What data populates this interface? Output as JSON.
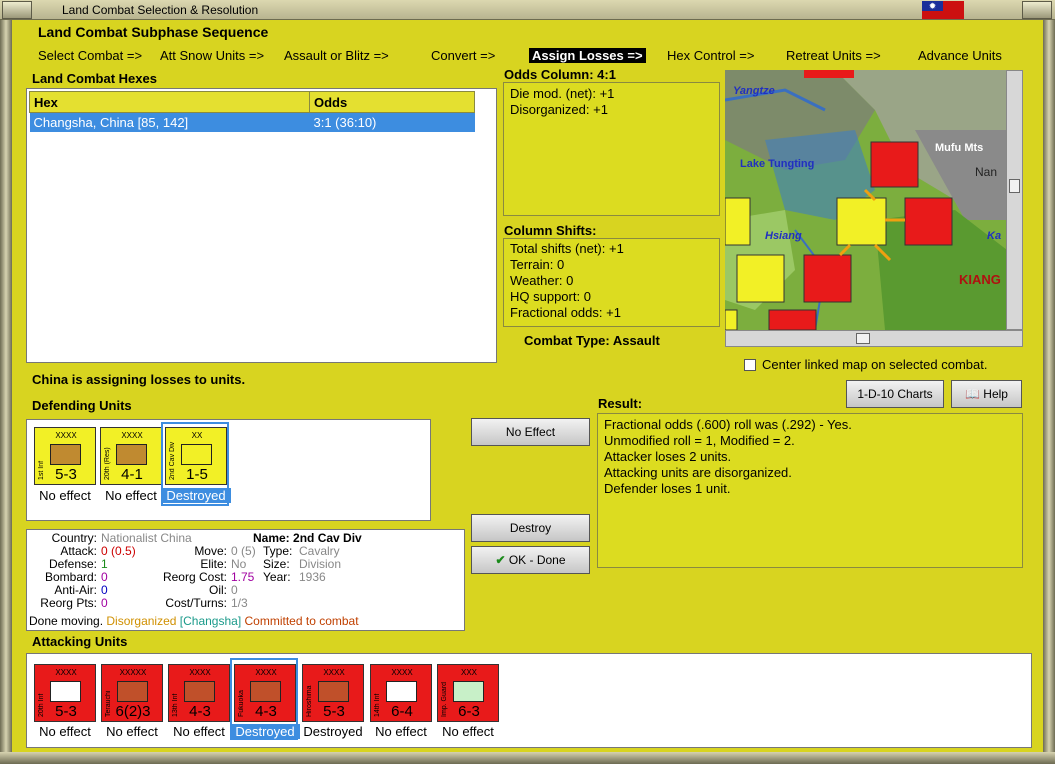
{
  "window": {
    "title": "Land Combat Selection & Resolution"
  },
  "subphase": {
    "header": "Land Combat Subphase Sequence",
    "steps": [
      "Select Combat =>",
      "Att Snow Units =>",
      "Assault or Blitz =>",
      "Convert =>",
      "Assign Losses =>",
      "Hex Control =>",
      "Retreat Units =>",
      "Advance Units"
    ],
    "active_index": 4
  },
  "hexes": {
    "header": "Land Combat Hexes",
    "col_hex": "Hex",
    "col_odds": "Odds",
    "rows": [
      {
        "hex": "Changsha, China [85, 142]",
        "odds": "3:1 (36:10)"
      }
    ]
  },
  "odds": {
    "header": "Odds Column: 4:1",
    "lines": [
      "Die mod. (net): +1",
      "Disorganized: +1"
    ]
  },
  "shifts": {
    "header": "Column Shifts:",
    "lines": [
      "Total shifts (net): +1",
      "Terrain: 0",
      "Weather: 0",
      "HQ support: 0",
      "Fractional odds: +1"
    ]
  },
  "combat_type": "Combat Type:  Assault",
  "map": {
    "labels": [
      "Yangtze",
      "Lake Tungting",
      "Mufu Mts",
      "Hsiang",
      "Nan",
      "KIANG",
      "Ka"
    ],
    "center_checkbox": "Center linked map on selected combat."
  },
  "status_message": "China is assigning losses to units.",
  "defending": {
    "header": "Defending Units",
    "units": [
      {
        "size": "XXXX",
        "name": "1st Inf",
        "value": "5-3",
        "status": "No effect",
        "color": "yel"
      },
      {
        "size": "XXXX",
        "name": "20th (Res)",
        "value": "4-1",
        "status": "No effect",
        "color": "yel"
      },
      {
        "size": "XX",
        "name": "2nd Cav Div",
        "value": "1-5",
        "status": "Destroyed",
        "color": "yel"
      }
    ]
  },
  "buttons": {
    "no_effect": "No Effect",
    "destroy": "Destroy",
    "ok_done": "OK - Done",
    "charts": "1-D-10 Charts",
    "help": "Help"
  },
  "result": {
    "header": "Result:",
    "lines": [
      "Fractional odds (.600) roll was (.292)  - Yes.",
      "Unmodified roll = 1, Modified = 2.",
      "Attacker loses 2 units.",
      "Attacking units are disorganized.",
      "Defender loses 1 unit."
    ]
  },
  "info": {
    "country_label": "Country:",
    "country": "Nationalist China",
    "name_label": "Name:",
    "name": "2nd Cav Div",
    "attack_label": "Attack:",
    "attack": "0",
    "attack_extra": "(0.5)",
    "move_label": "Move:",
    "move": "0",
    "move_extra": "(5)",
    "type_label": "Type:",
    "type": "Cavalry",
    "defense_label": "Defense:",
    "defense": "1",
    "elite_label": "Elite:",
    "elite": "No",
    "size_label": "Size:",
    "size": "Division",
    "bombard_label": "Bombard:",
    "bombard": "0",
    "reorg_cost_label": "Reorg Cost:",
    "reorg_cost": "1.75",
    "year_label": "Year:",
    "year": "1936",
    "antiair_label": "Anti-Air:",
    "antiair": "0",
    "oil_label": "Oil:",
    "oil": "0",
    "reorg_pts_label": "Reorg Pts:",
    "reorg_pts": "0",
    "cost_turns_label": "Cost/Turns:",
    "cost_turns": "1/3",
    "done": "Done moving.",
    "disorganized": "Disorganized",
    "location": "[Changsha]",
    "committed": "Committed to combat"
  },
  "attacking": {
    "header": "Attacking Units",
    "units": [
      {
        "size": "XXXX",
        "name": "20th Inf",
        "value": "5-3",
        "status": "No effect"
      },
      {
        "size": "XXXXX",
        "name": "Terauchi",
        "value": "6(2)3",
        "status": "No effect"
      },
      {
        "size": "XXXX",
        "name": "13th Inf",
        "value": "4-3",
        "status": "No effect"
      },
      {
        "size": "XXXX",
        "name": "Fukuoka",
        "value": "4-3",
        "status": "Destroyed"
      },
      {
        "size": "XXXX",
        "name": "Hiroshima",
        "value": "5-3",
        "status": "Destroyed"
      },
      {
        "size": "XXXX",
        "name": "14th Inf",
        "value": "6-4",
        "status": "No effect"
      },
      {
        "size": "XXX",
        "name": "Imp. Guard",
        "value": "6-3",
        "status": "No effect"
      }
    ]
  }
}
